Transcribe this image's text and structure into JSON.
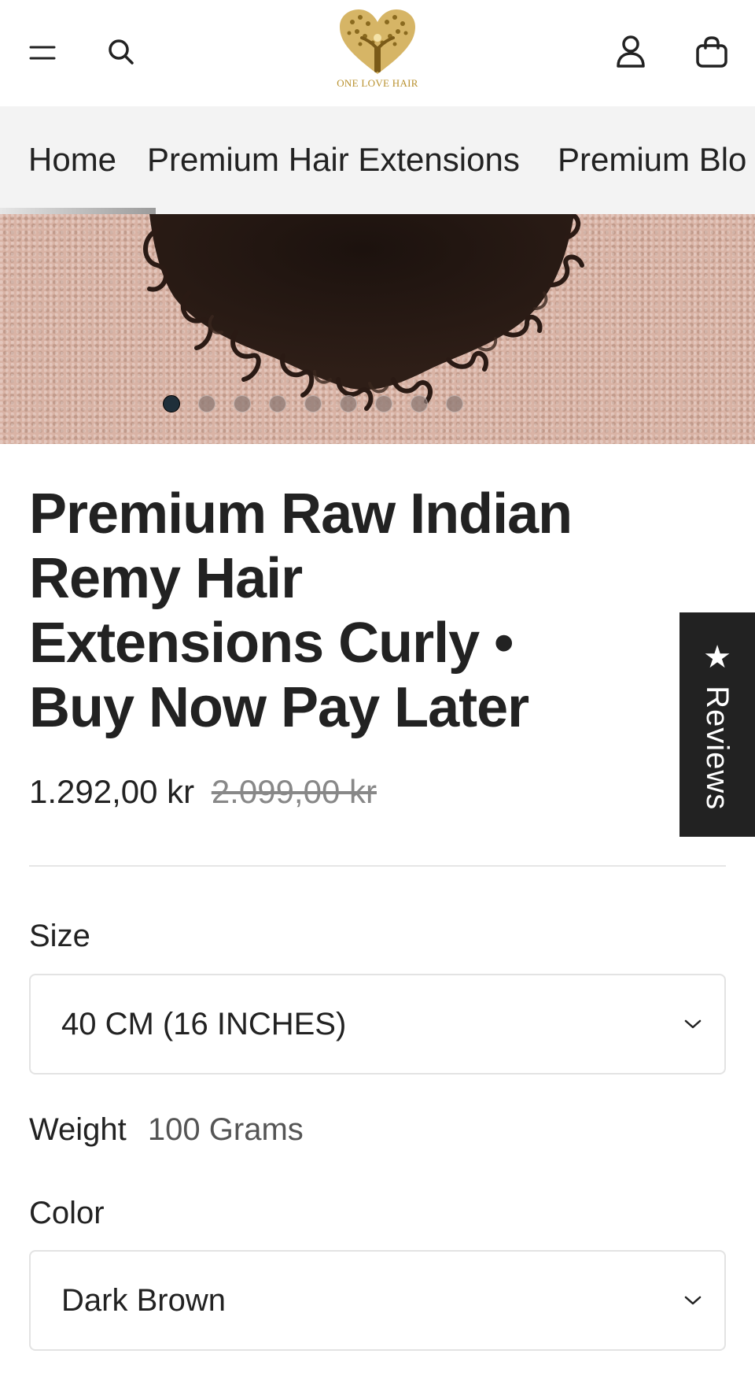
{
  "header": {
    "logo_text": "ONE LOVE HAIR",
    "icons": [
      "menu-icon",
      "search-icon",
      "user-icon",
      "cart-icon"
    ],
    "brand_color": "#b8902c"
  },
  "nav": {
    "items": [
      {
        "label": "Home"
      },
      {
        "label": "Premium Hair Extensions"
      },
      {
        "label": "Premium Blo"
      }
    ]
  },
  "hero": {
    "slide_count": 9,
    "active_slide": 1
  },
  "reviews_tab": {
    "label": "★ Reviews"
  },
  "product": {
    "title": "Premium Raw Indian Remy Hair Extensions Curly • Buy Now Pay Later",
    "price": "1.292,00 kr",
    "compare_price": "2.099,00 kr"
  },
  "options": {
    "size": {
      "label": "Size",
      "value": "40 CM (16 INCHES)"
    },
    "weight": {
      "label": "Weight",
      "value": "100 Grams"
    },
    "color": {
      "label": "Color",
      "value": "Dark Brown"
    }
  }
}
